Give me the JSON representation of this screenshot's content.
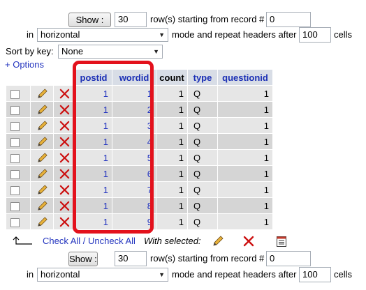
{
  "nav_top": {
    "show_button": "Show :",
    "rows_value": "30",
    "rows_text": "row(s) starting from record #",
    "record_value": "0",
    "in_text": "in",
    "mode_value": "horizontal",
    "headers_text": "mode and repeat headers after",
    "headers_value": "100",
    "cells_text": "cells"
  },
  "sort": {
    "label": "Sort by key:",
    "value": "None"
  },
  "options_link": "+ Options",
  "table": {
    "columns": [
      "postid",
      "wordid",
      "count",
      "type",
      "questionid"
    ],
    "rows": [
      {
        "postid": "1",
        "wordid": "1",
        "count": "1",
        "type": "Q",
        "questionid": "1"
      },
      {
        "postid": "1",
        "wordid": "2",
        "count": "1",
        "type": "Q",
        "questionid": "1"
      },
      {
        "postid": "1",
        "wordid": "3",
        "count": "1",
        "type": "Q",
        "questionid": "1"
      },
      {
        "postid": "1",
        "wordid": "4",
        "count": "1",
        "type": "Q",
        "questionid": "1"
      },
      {
        "postid": "1",
        "wordid": "5",
        "count": "1",
        "type": "Q",
        "questionid": "1"
      },
      {
        "postid": "1",
        "wordid": "6",
        "count": "1",
        "type": "Q",
        "questionid": "1"
      },
      {
        "postid": "1",
        "wordid": "7",
        "count": "1",
        "type": "Q",
        "questionid": "1"
      },
      {
        "postid": "1",
        "wordid": "8",
        "count": "1",
        "type": "Q",
        "questionid": "1"
      },
      {
        "postid": "1",
        "wordid": "9",
        "count": "1",
        "type": "Q",
        "questionid": "1"
      }
    ]
  },
  "bulk": {
    "check_all_text": "Check All / Uncheck All",
    "with_selected_text": "With selected:"
  },
  "nav_bottom": {
    "show_button": "Show :",
    "rows_value": "30",
    "rows_text": "row(s) starting from record #",
    "record_value": "0",
    "in_text": "in",
    "mode_value": "horizontal",
    "headers_text": "mode and repeat headers after",
    "headers_value": "100",
    "cells_text": "cells"
  },
  "colors": {
    "highlight": "#e3111c",
    "link": "#2435bf",
    "header_bg": "#d8dde6"
  },
  "icons": [
    "checkbox",
    "pencil-icon",
    "delete-x-icon",
    "export-icon",
    "arrow-up-icon"
  ]
}
